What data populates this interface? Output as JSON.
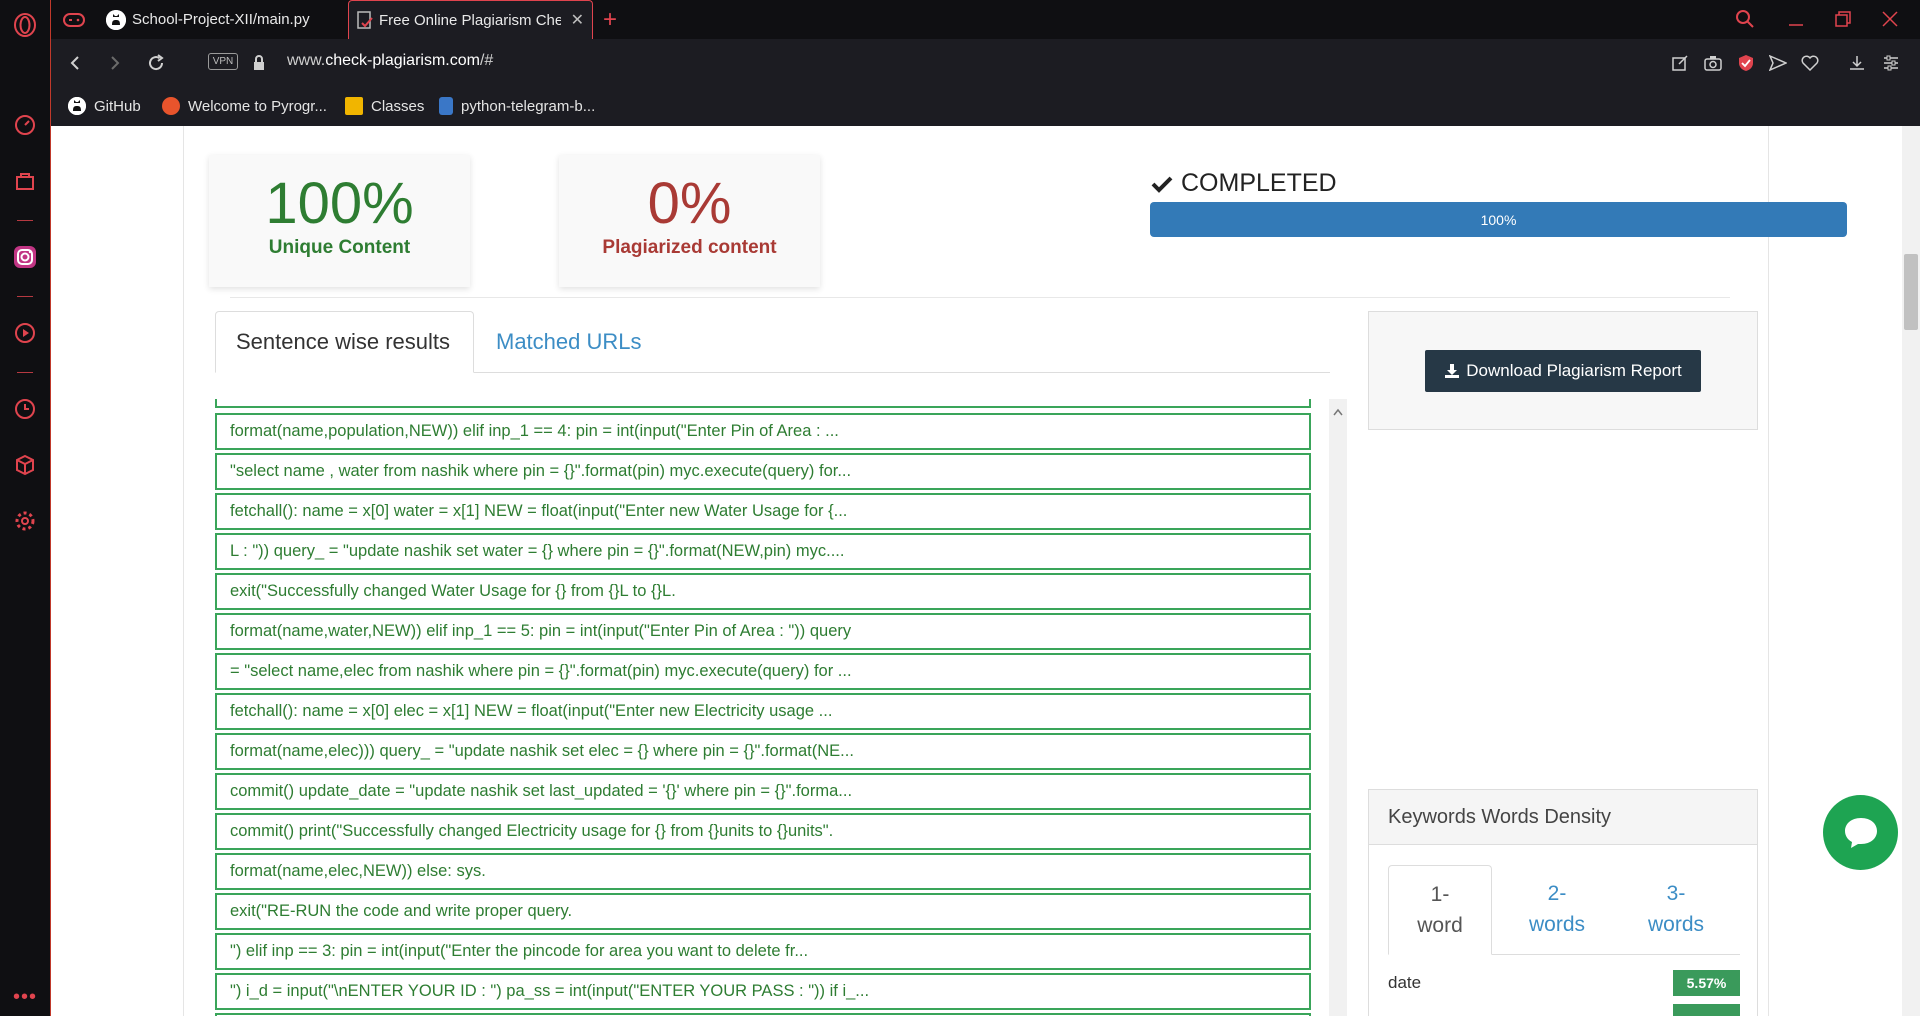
{
  "browser": {
    "tabs": [
      {
        "label": "School-Project-XII/main.py",
        "icon": "github-icon",
        "active": false
      },
      {
        "label": "Free Online Plagiarism Che",
        "icon": "document-icon",
        "active": true
      }
    ],
    "new_tab_symbol": "+",
    "address": {
      "vpn_label": "VPN",
      "url_prefix": "www.",
      "url_host": "check-plagiarism.com",
      "url_suffix": "/#"
    },
    "bookmarks": [
      {
        "label": "GitHub",
        "icon": "github-icon"
      },
      {
        "label": "Welcome to Pyrogr...",
        "icon": "pyrogram-icon"
      },
      {
        "label": "Classes",
        "icon": "classroom-icon"
      },
      {
        "label": "python-telegram-b...",
        "icon": "telegram-bot-icon"
      }
    ],
    "accent_color": "#e0444e"
  },
  "stats": {
    "unique_value": "100%",
    "unique_label": "Unique Content",
    "plag_value": "0%",
    "plag_label": "Plagiarized content",
    "status_label": "COMPLETED",
    "progress_text": "100%",
    "progress_fraction": 1.0
  },
  "tabs": {
    "sentence": "Sentence wise results",
    "urls": "Matched URLs"
  },
  "results": [
    "format(name,population,NEW)) elif inp_1 == 4: pin = int(input(\"Enter Pin of Area : ...",
    "\"select name , water from nashik where pin = {}\".format(pin) myc.execute(query) for...",
    "fetchall(): name = x[0] water = x[1] NEW = float(input(\"Enter new Water Usage for {...",
    "L : \")) query_ = \"update nashik set water = {} where pin = {}\".format(NEW,pin) myc....",
    "exit(\"Successfully changed Water Usage for {} from {}L to {}L.",
    "format(name,water,NEW)) elif inp_1 == 5: pin = int(input(\"Enter Pin of Area : \")) query",
    "= \"select name,elec from nashik where pin = {}\".format(pin) myc.execute(query) for ...",
    "fetchall(): name = x[0] elec = x[1] NEW = float(input(\"Enter new Electricity usage ...",
    "format(name,elec))) query_ = \"update nashik set elec = {} where pin = {}\".format(NE...",
    "commit() update_date = \"update nashik set last_updated = '{}' where pin = {}\".forma...",
    "commit() print(\"Successfully changed Electricity usage for {} from {}units to {}units\".",
    "format(name,elec,NEW)) else: sys.",
    "exit(\"RE-RUN the code and write proper query.",
    "\") elif inp == 3: pin = int(input(\"Enter the pincode for area you want to delete fr...",
    "\") i_d = input(\"\\nENTER YOUR ID : \") pa_ss = int(input(\"ENTER YOUR PASS : \")) if i_..."
  ],
  "download": {
    "label": "Download Plagiarism Report",
    "icon": "download-icon"
  },
  "keywords": {
    "title": "Keywords Words Density",
    "tabs": [
      {
        "line1": "1-",
        "line2": "word"
      },
      {
        "line1": "2-",
        "line2": "words"
      },
      {
        "line1": "3-",
        "line2": "words"
      }
    ],
    "rows": [
      {
        "word": "date",
        "density": "5.57%"
      }
    ]
  },
  "colors": {
    "unique_green": "#2e7d32",
    "plag_red": "#a93a35",
    "progress_blue": "#337ab7",
    "row_border_green": "#3aa55a",
    "badge_green": "#3a9a5b",
    "download_btn": "#263846",
    "chat_green": "#1ea452"
  }
}
